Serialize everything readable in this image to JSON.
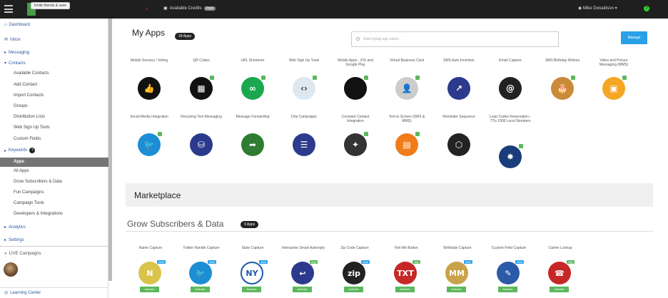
{
  "topbar": {
    "tooltip": "Invite friends & save",
    "credits_label": "Available Credits",
    "credits_badge": "Free",
    "user_name": "Mike Donaldson",
    "help": "?"
  },
  "sidebar": {
    "items": [
      {
        "label": "Dashboard"
      },
      {
        "label": "Inbox"
      },
      {
        "label": "Messaging"
      },
      {
        "label": "Contacts"
      },
      {
        "label": "Available Contacts"
      },
      {
        "label": "Add Contact"
      },
      {
        "label": "Import Contacts"
      },
      {
        "label": "Groups"
      },
      {
        "label": "Distribution Lists"
      },
      {
        "label": "Web Sign Up Tools"
      },
      {
        "label": "Custom Fields"
      },
      {
        "label": "Keywords"
      },
      {
        "label": "Apps"
      },
      {
        "label": "All Apps"
      },
      {
        "label": "Grow Subscribers & Data"
      },
      {
        "label": "Fun Campaigns"
      },
      {
        "label": "Campaign Tools"
      },
      {
        "label": "Developers & Integrations"
      },
      {
        "label": "Analytics"
      },
      {
        "label": "Settings"
      },
      {
        "label": "LIVE Campaigns"
      },
      {
        "label": "Learning Center"
      }
    ],
    "keywords_badge": "?"
  },
  "main": {
    "my_apps_title": "My Apps",
    "my_apps_count": "18 Apps",
    "search_placeholder": "Start typing app name...",
    "manage_label": "Manage",
    "apps": [
      {
        "label": "Mobile Surveys / Voting",
        "color": "#111111",
        "glyph": "👍",
        "check": false
      },
      {
        "label": "QR Codes",
        "color": "#111111",
        "glyph": "▦",
        "check": true
      },
      {
        "label": "URL Shortener",
        "color": "#1aa84f",
        "glyph": "∞",
        "check": true
      },
      {
        "label": "Web Sign Up Tools",
        "color": "#dde8f0",
        "glyph": "‹›",
        "check": true
      },
      {
        "label": "Mobile Apps - iOS and Google Play",
        "color": "#111111",
        "glyph": "",
        "check": true
      },
      {
        "label": "Virtual Business Card",
        "color": "#cccccc",
        "glyph": "👤",
        "check": true
      },
      {
        "label": "SMS Auto Incentive",
        "color": "#2b3a8c",
        "glyph": "↗",
        "check": false
      },
      {
        "label": "Email Capture",
        "color": "#222222",
        "glyph": "@",
        "check": false
      },
      {
        "label": "SMS Birthday Wishes",
        "color": "#c98a3a",
        "glyph": "🎂",
        "check": true
      },
      {
        "label": "Video and Picture Messaging (MMS)",
        "color": "#f5a623",
        "glyph": "▣",
        "check": true
      },
      {
        "label": "Social Media Integration",
        "color": "#1d8ed4",
        "glyph": "🐦",
        "check": true
      },
      {
        "label": "Recurring Text Messaging",
        "color": "#2b3a8c",
        "glyph": "⛁",
        "check": false
      },
      {
        "label": "Message Forwarding",
        "color": "#2e7d32",
        "glyph": "➦",
        "check": false
      },
      {
        "label": "Drip Campaigns",
        "color": "#2b3a8c",
        "glyph": "☰",
        "check": false
      },
      {
        "label": "Constant Contact Integration",
        "color": "#333333",
        "glyph": "✦",
        "check": true
      },
      {
        "label": "Text to Screen (SMS & MMS)",
        "color": "#f07d1a",
        "glyph": "▤",
        "check": true
      },
      {
        "label": "Reminder Sequence",
        "color": "#222222",
        "glyph": "⬡",
        "check": false
      },
      {
        "label": "Loop Codes Reservation - 77Is 1000 Local Numbers",
        "color": "#1a3c7a",
        "glyph": "✸",
        "check": true
      }
    ],
    "marketplace_title": "Marketplace",
    "grow_title": "Grow Subscribers & Data",
    "grow_count": "9 Apps",
    "market_apps": [
      {
        "label": "Name Capture",
        "color": "#d9c34a",
        "glyph": "N",
        "tag": "Web",
        "activate": "Activate"
      },
      {
        "label": "Twitter Handle Capture",
        "color": "#1d8ed4",
        "glyph": "🐦",
        "tag": "Web",
        "activate": "Activate"
      },
      {
        "label": "State Capture",
        "color": "#ffffff",
        "glyph": "NY",
        "tag": "Web",
        "activate": "Activate"
      },
      {
        "label": "Interactive Smart Autoreply",
        "color": "#2b3a8c",
        "glyph": "↩",
        "tag": "App",
        "activate": "Activate"
      },
      {
        "label": "Zip Code Capture",
        "color": "#222222",
        "glyph": "zip",
        "tag": "Web",
        "activate": "Activate"
      },
      {
        "label": "Text Me Button",
        "color": "#c62828",
        "glyph": "TXT",
        "tag": "App",
        "activate": "Activate"
      },
      {
        "label": "Birthdate Capture",
        "color": "#c9a24a",
        "glyph": "MM",
        "tag": "Web",
        "activate": "Activate"
      },
      {
        "label": "Custom Field Capture",
        "color": "#2b5aa8",
        "glyph": "✎",
        "tag": "Web",
        "activate": "Activate"
      },
      {
        "label": "Carrier Lookup",
        "color": "#c62828",
        "glyph": "☎",
        "tag": "App",
        "activate": "Activate"
      }
    ]
  }
}
